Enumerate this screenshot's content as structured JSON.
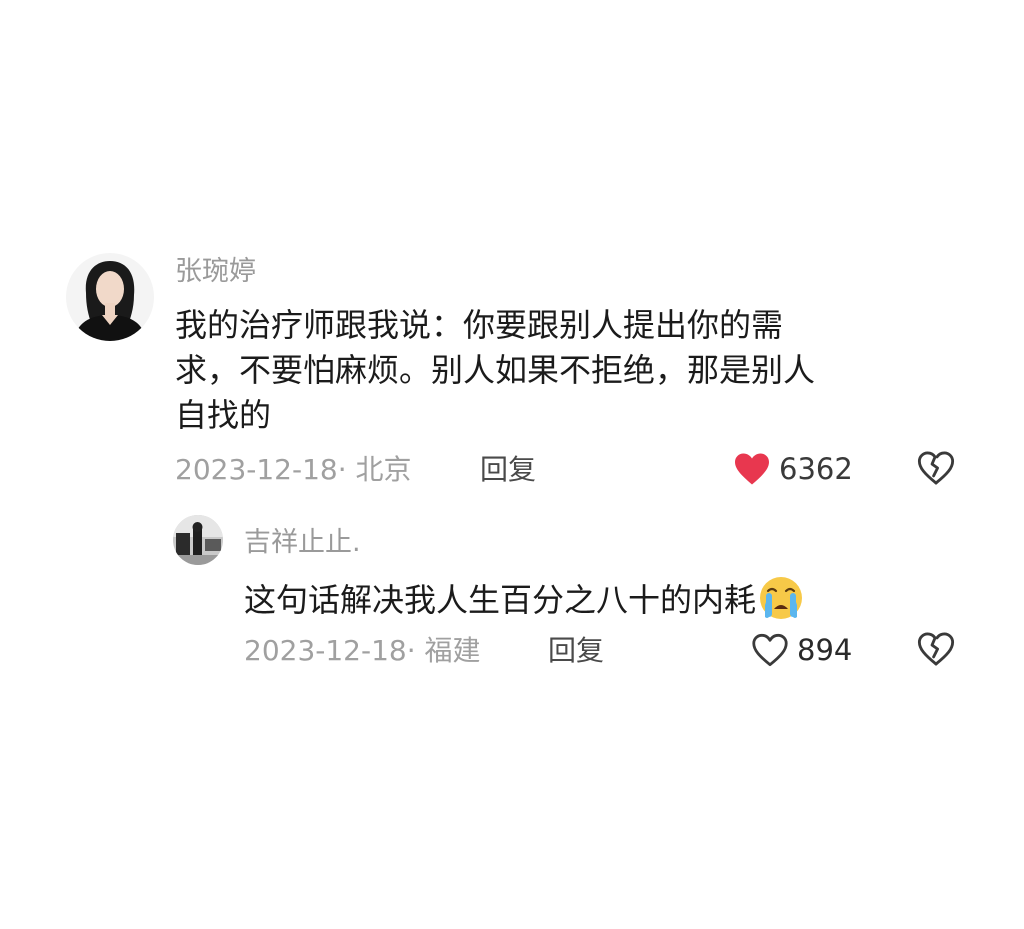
{
  "comments": [
    {
      "username": "张琬婷",
      "text_lines": [
        "我的治疗师跟我说：你要跟别人提出你的需",
        "求，不要怕麻烦。别人如果不拒绝，那是别人",
        "自找的"
      ],
      "meta": "2023-12-18· 北京",
      "reply_label": "回复",
      "likes": "6362",
      "liked": true,
      "like_icon": "heart-filled-icon",
      "dislike_icon": "broken-heart-icon",
      "avatar_icon": "user-avatar-portrait"
    },
    {
      "username": "吉祥止止.",
      "text_lines": [
        "这句话解决我人生百分之八十的内耗"
      ],
      "emoji": "crying-face-emoji",
      "meta": "2023-12-18· 福建",
      "reply_label": "回复",
      "likes": "894",
      "liked": false,
      "like_icon": "heart-outline-icon",
      "dislike_icon": "broken-heart-icon",
      "avatar_icon": "user-avatar-photo"
    }
  ],
  "colors": {
    "like_active": "#e8374f",
    "username": "#9a9a9a",
    "meta": "#a0a0a0",
    "body_text": "#1b1b1b"
  }
}
